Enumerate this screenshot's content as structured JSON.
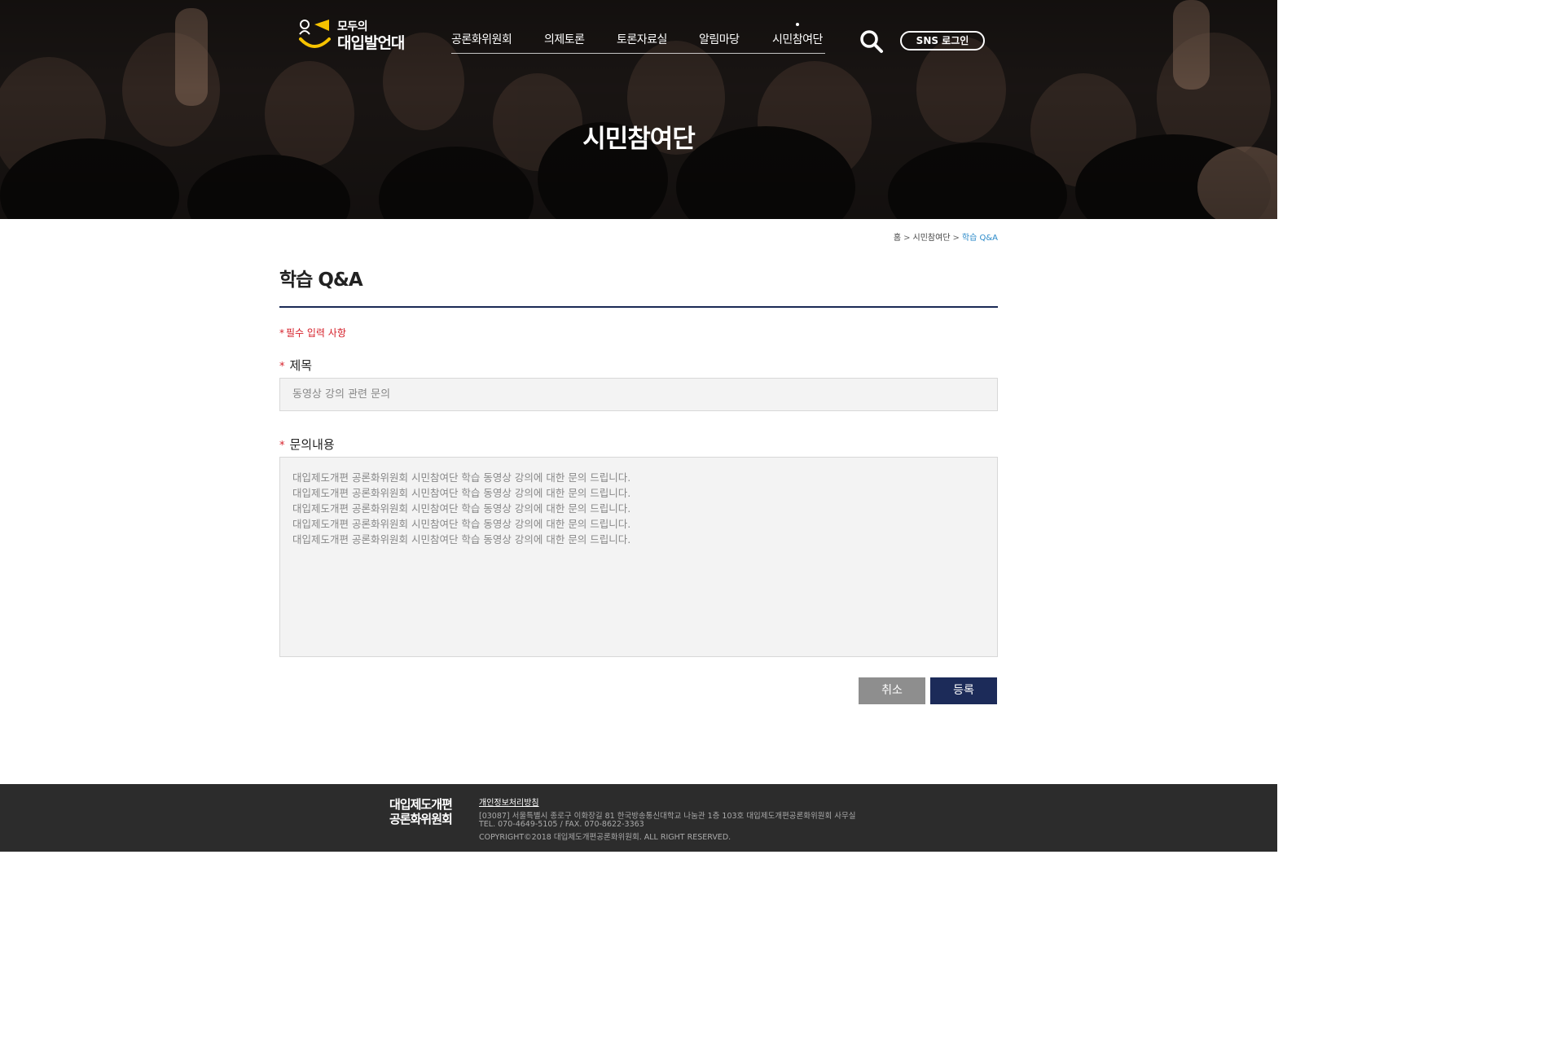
{
  "header": {
    "logo": {
      "line1": "모두의",
      "line2": "대입발언대"
    },
    "nav": [
      "공론화위원회",
      "의제토론",
      "토론자료실",
      "알림마당",
      "시민참여단"
    ],
    "sns_login": "SNS 로그인",
    "hero_title": "시민참여단"
  },
  "breadcrumb": {
    "home": "홈",
    "section": "시민참여단",
    "current": "학습 Q&A"
  },
  "main": {
    "title": "학습 Q&A",
    "required_note": "필수 입력 사항",
    "required_mark": "*",
    "fields": {
      "title_label": "제목",
      "title_value": "동영상 강의 관련 문의",
      "content_label": "문의내용",
      "content_value": "대입제도개편 공론화위원회 시민참여단 학습 동영상 강의에 대한 문의 드립니다.\n대입제도개편 공론화위원회 시민참여단 학습 동영상 강의에 대한 문의 드립니다.\n대입제도개편 공론화위원회 시민참여단 학습 동영상 강의에 대한 문의 드립니다.\n대입제도개편 공론화위원회 시민참여단 학습 동영상 강의에 대한 문의 드립니다.\n대입제도개편 공론화위원회 시민참여단 학습 동영상 강의에 대한 문의 드립니다."
    },
    "buttons": {
      "cancel": "취소",
      "submit": "등록"
    }
  },
  "footer": {
    "logo_line1": "대입제도개편",
    "logo_line2": "공론화위원회",
    "privacy": "개인정보처리방침",
    "address": "[03087] 서울특별시 종로구 이화장길 81 한국방송통신대학교 나눔관 1층 103호 대입제도개편공론화위원회 사무실",
    "tel": "TEL. 070-4649-5105 / FAX. 070-8622-3363",
    "copyright": "COPYRIGHT©2018 대입제도개편공론화위원회. ALL RIGHT RESERVED."
  },
  "colors": {
    "accent": "#1c2b59",
    "required": "#d6202a",
    "breadcrumb_current": "#2a8ac9",
    "footer_bg": "#2c2c2c"
  }
}
